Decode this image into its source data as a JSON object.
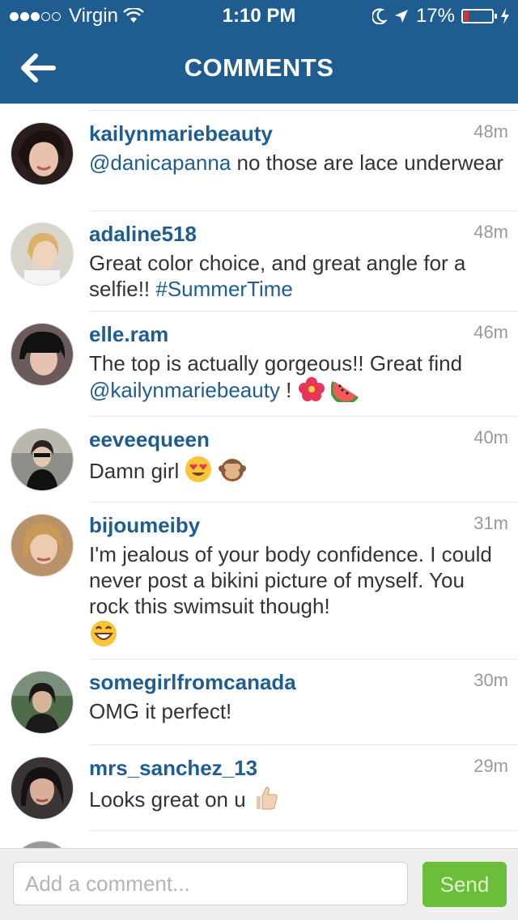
{
  "status_bar": {
    "carrier": "Virgin",
    "time": "1:10 PM",
    "battery_text": "17%",
    "battery_level": 0.17,
    "battery_color": "#e0302b",
    "icons": [
      "signal-dots-icon",
      "wifi-icon",
      "moon-icon",
      "location-arrow-icon",
      "battery-icon",
      "charging-bolt-icon"
    ]
  },
  "nav": {
    "title": "COMMENTS",
    "back_icon": "arrow-left-icon",
    "bg_color": "#1f5d91"
  },
  "comments": [
    {
      "user": "kailynmariebeauty",
      "time": "48m",
      "mention": "@danicapanna",
      "text": " no those are lace underwear"
    },
    {
      "user": "adaline518",
      "time": "48m",
      "text": "Great color choice, and great angle for a selfie!! ",
      "hashtag": "#SummerTime"
    },
    {
      "user": "elle.ram",
      "time": "46m",
      "text_before": "The top is actually gorgeous!! Great find ",
      "mention": "@kailynmariebeauty",
      "text_after": " ! ",
      "emojis": [
        "hibiscus-emoji",
        "watermelon-emoji"
      ]
    },
    {
      "user": "eeveequeen",
      "time": "40m",
      "text": "Damn girl ",
      "emojis": [
        "heart-eyes-emoji",
        "see-no-evil-monkey-emoji"
      ]
    },
    {
      "user": "bijoumeiby",
      "time": "31m",
      "text": "I'm jealous of your body confidence. I could never post a bikini picture of myself. You rock this swimsuit though!",
      "emojis": [
        "grinning-emoji"
      ]
    },
    {
      "user": "somegirlfromcanada",
      "time": "30m",
      "text": "OMG it perfect!"
    },
    {
      "user": "mrs_sanchez_13",
      "time": "29m",
      "text": "Looks great on u ",
      "emojis": [
        "thumbs-up-emoji"
      ]
    }
  ],
  "composer": {
    "placeholder": "Add a comment...",
    "send_label": "Send",
    "send_color": "#6bbd3a"
  }
}
